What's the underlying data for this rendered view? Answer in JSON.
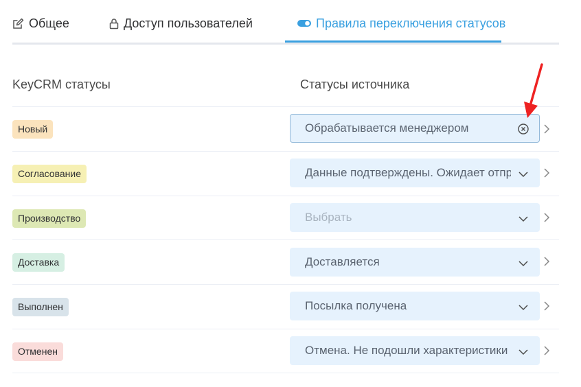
{
  "tabs": [
    {
      "label": "Общее",
      "icon": "edit-icon",
      "active": false
    },
    {
      "label": "Доступ пользователей",
      "icon": "lock-icon",
      "active": false
    },
    {
      "label": "Правила переключения статусов",
      "icon": "toggle-icon",
      "active": true
    }
  ],
  "columns": {
    "keycrm": "KeyCRM статусы",
    "source": "Статусы источника"
  },
  "rows": [
    {
      "badge": "Новый",
      "badge_color": "#fbe3bd",
      "value": "Обрабатывается менеджером",
      "placeholder": false,
      "control": "clear"
    },
    {
      "badge": "Согласование",
      "badge_color": "#f6f0b4",
      "value": "Данные подтверждены. Ожидает отправки",
      "placeholder": false,
      "control": "dropdown"
    },
    {
      "badge": "Производство",
      "badge_color": "#dde8b4",
      "value": "Выбрать",
      "placeholder": true,
      "control": "dropdown"
    },
    {
      "badge": "Доставка",
      "badge_color": "#d6efe3",
      "value": "Доставляется",
      "placeholder": false,
      "control": "dropdown"
    },
    {
      "badge": "Выполнен",
      "badge_color": "#d8e3ea",
      "value": "Посылка получена",
      "placeholder": false,
      "control": "dropdown"
    },
    {
      "badge": "Отменен",
      "badge_color": "#fadcda",
      "value": "Отмена. Не подошли характеристики",
      "placeholder": false,
      "control": "dropdown"
    }
  ],
  "colors": {
    "accent": "#3aa0e0",
    "select_bg": "#e6f2fd",
    "annotation_arrow": "#ee2222"
  }
}
